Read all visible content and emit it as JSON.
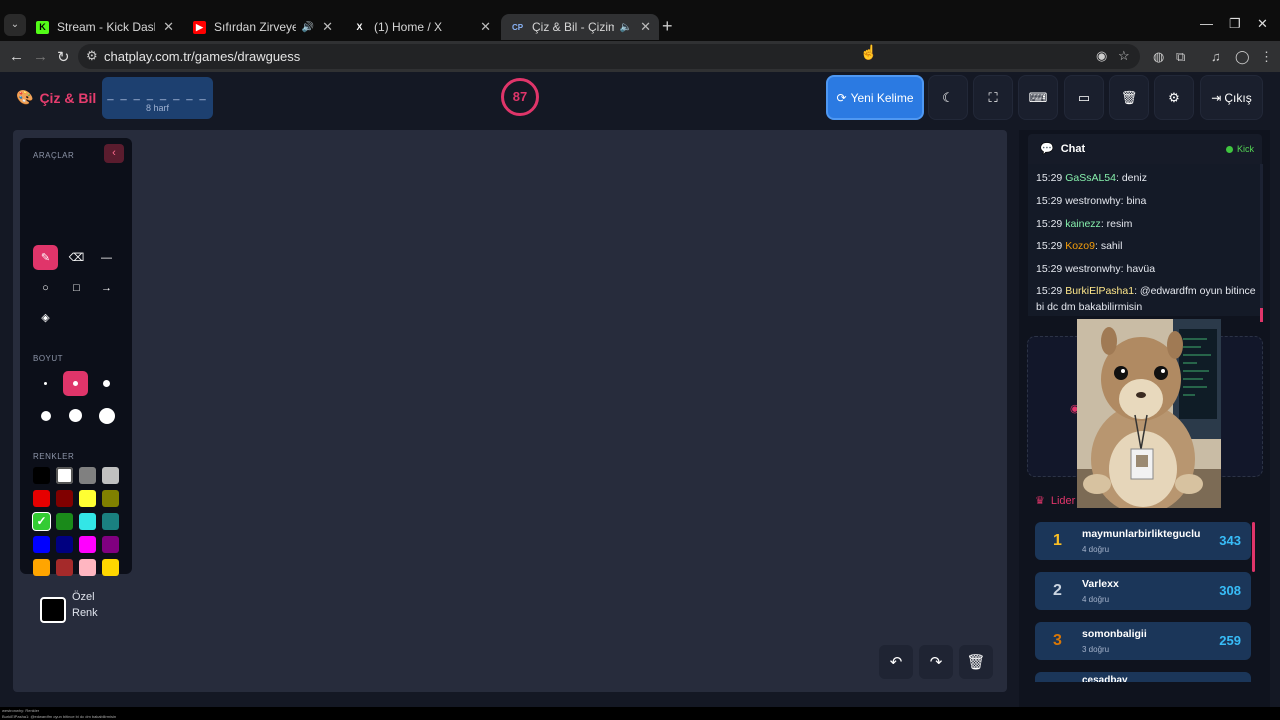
{
  "browser": {
    "tabs": [
      {
        "title": "Stream - Kick Dashboard",
        "favicon": "kick-icon",
        "active": false
      },
      {
        "title": "Sıfırdan Zirveye - YouTube",
        "favicon": "youtube-icon",
        "active": false
      },
      {
        "title": "(1) Home / X",
        "favicon": "x-icon",
        "active": false
      },
      {
        "title": "Çiz & Bil - Çizim Oyunu",
        "favicon": "chatplay-icon",
        "active": true
      }
    ],
    "url": "chatplay.com.tr/games/drawguess"
  },
  "header": {
    "logo": "Çiz & Bil",
    "word_mask": "_ _ _ _ _ _ _ _",
    "word_length": "8 harf",
    "timer": "87",
    "new_word_label": "Yeni Kelime",
    "exit_label": "Çıkış"
  },
  "tools": {
    "tools_label": "ARAÇLAR",
    "size_label": "BOYUT",
    "colors_label": "RENKLER",
    "custom_color_label": "Özel Renk",
    "colors": [
      "#000000",
      "#ffffff",
      "#808080",
      "#c0c0c0",
      "#e60000",
      "#800000",
      "#ffff33",
      "#808000",
      "#33cc33",
      "#1a8a1a",
      "#33e6e6",
      "#1a8080",
      "#0000ff",
      "#000080",
      "#ff00ff",
      "#800080",
      "#ffa500",
      "#a52a2a",
      "#ffb6c1",
      "#ffd700"
    ],
    "selected_color": "#33cc33"
  },
  "chat": {
    "title": "Chat",
    "source": "Kick",
    "messages": [
      {
        "time": "15:29",
        "user": "GaSsAL54",
        "color": "#86efac",
        "text": "deniz"
      },
      {
        "time": "15:29",
        "user": "westronwhy",
        "color": "#e6e9f0",
        "text": "bina"
      },
      {
        "time": "15:29",
        "user": "kainezz",
        "color": "#86efac",
        "text": "resim"
      },
      {
        "time": "15:29",
        "user": "Kozo9",
        "color": "#f59e0b",
        "text": "sahil"
      },
      {
        "time": "15:29",
        "user": "westronwhy",
        "color": "#e6e9f0",
        "text": "havüa"
      },
      {
        "time": "15:29",
        "user": "BurkiElPasha1",
        "color": "#fde68a",
        "text": "@edwardfm oyun bitince bi dc dm bakabilirmisin"
      }
    ]
  },
  "leaderboard": {
    "title": "Lider",
    "entries": [
      {
        "rank": "1",
        "name": "maymunlarbirlikteguclu",
        "correct": "4 doğru",
        "score": "343",
        "rank_color": "#fbbf24"
      },
      {
        "rank": "2",
        "name": "Varlexx",
        "correct": "4 doğru",
        "score": "308",
        "rank_color": "#cbd5e1"
      },
      {
        "rank": "3",
        "name": "somonbaligii",
        "correct": "3 doğru",
        "score": "259",
        "rank_color": "#d97706"
      }
    ],
    "peek_name": "cesadbay"
  },
  "bottom": {
    "line1": "westronwhy: Renkler",
    "line2": "BurkiElPasha1: @edwardfm oyun bitince bi dc dm bakabilirmisin"
  }
}
